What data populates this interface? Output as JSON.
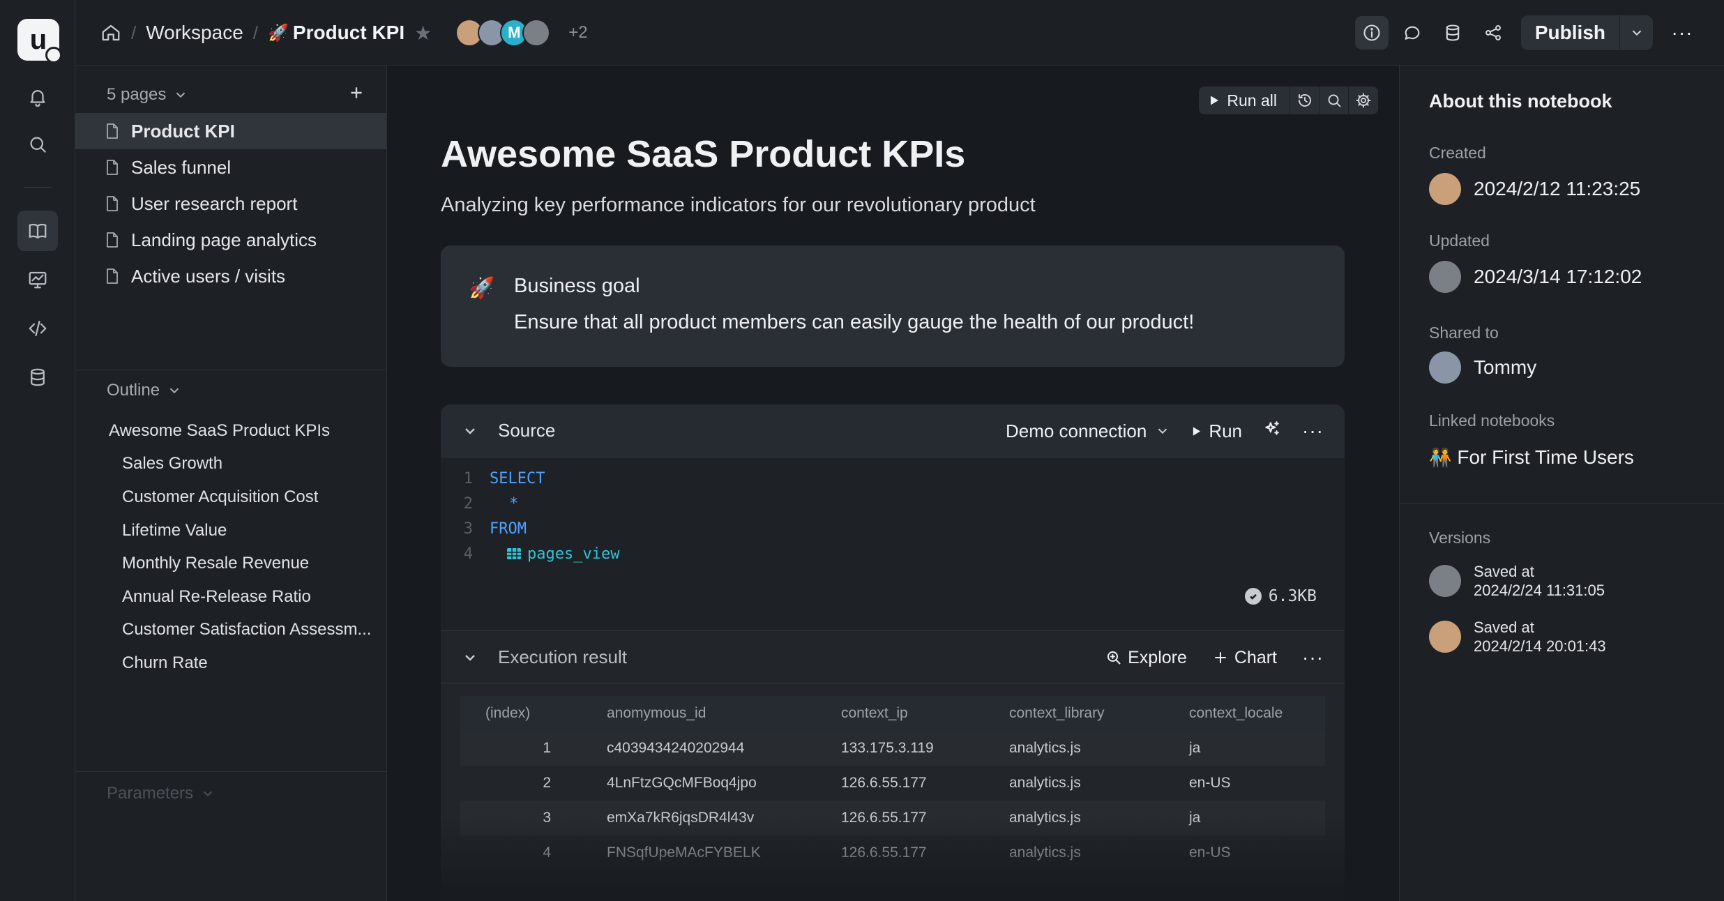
{
  "topbar": {
    "breadcrumb": {
      "workspace": "Workspace",
      "page_emoji": "🚀",
      "page": "Product KPI"
    },
    "collaborators": [
      {
        "initial": "",
        "color": "#c9a07a"
      },
      {
        "initial": "",
        "color": "#8a96a8"
      },
      {
        "initial": "M",
        "color": "#2bb0c9"
      },
      {
        "initial": "",
        "color": "#7b7f86"
      }
    ],
    "more_collaborators": "+2",
    "publish_label": "Publish"
  },
  "sidebar": {
    "pages_header": "5 pages",
    "pages": [
      {
        "label": "Product KPI",
        "active": true
      },
      {
        "label": "Sales funnel"
      },
      {
        "label": "User research report"
      },
      {
        "label": "Landing page analytics"
      },
      {
        "label": "Active users / visits"
      }
    ],
    "outline_header": "Outline",
    "outline": [
      {
        "label": "Awesome SaaS Product KPIs",
        "level": 1
      },
      {
        "label": "Sales Growth",
        "level": 2
      },
      {
        "label": "Customer Acquisition Cost",
        "level": 2
      },
      {
        "label": "Lifetime Value",
        "level": 2
      },
      {
        "label": "Monthly Resale Revenue",
        "level": 2
      },
      {
        "label": "Annual Re-Release Ratio",
        "level": 2
      },
      {
        "label": "Customer Satisfaction Assessm...",
        "level": 2
      },
      {
        "label": "Churn Rate",
        "level": 2
      }
    ],
    "parameters_header": "Parameters"
  },
  "main": {
    "run_all_label": "Run all",
    "title": "Awesome SaaS Product KPIs",
    "subtitle": "Analyzing key performance indicators for our revolutionary product",
    "callout": {
      "emoji": "🚀",
      "heading": "Business goal",
      "body": "Ensure that all product members can easily gauge the health of our product!"
    },
    "cell": {
      "name": "Source",
      "connection": "Demo connection",
      "run_label": "Run",
      "code": [
        {
          "ln": "1",
          "text": "SELECT",
          "kind": "kw"
        },
        {
          "ln": "2",
          "text": "*",
          "kind": "kw"
        },
        {
          "ln": "3",
          "text": "FROM",
          "kind": "kw"
        },
        {
          "ln": "4",
          "text": "pages_view",
          "kind": "table"
        }
      ],
      "size": "6.3KB",
      "result": {
        "name": "Execution result",
        "explore_label": "Explore",
        "chart_label": "Chart",
        "columns": [
          "(index)",
          "anomymous_id",
          "context_ip",
          "context_library",
          "context_locale"
        ],
        "rows": [
          [
            "1",
            "c4039434240202944",
            "133.175.3.119",
            "analytics.js",
            "ja"
          ],
          [
            "2",
            "4LnFtzGQcMFBoq4jpo",
            "126.6.55.177",
            "analytics.js",
            "en-US"
          ],
          [
            "3",
            "emXa7kR6jqsDR4l43v",
            "126.6.55.177",
            "analytics.js",
            "ja"
          ],
          [
            "4",
            "FNSqfUpeMAcFYBELK",
            "126.6.55.177",
            "analytics.js",
            "en-US"
          ]
        ]
      }
    }
  },
  "rpanel": {
    "title": "About this notebook",
    "created_label": "Created",
    "created": "2024/2/12 11:23:25",
    "updated_label": "Updated",
    "updated": "2024/3/14 17:12:02",
    "shared_label": "Shared to",
    "shared": "Tommy",
    "linked_label": "Linked notebooks",
    "linked_emoji": "🧑‍🤝‍🧑",
    "linked": "For First Time Users",
    "versions_label": "Versions",
    "versions": [
      {
        "label": "Saved at",
        "time": "2024/2/24 11:31:05"
      },
      {
        "label": "Saved at",
        "time": "2024/2/14 20:01:43"
      }
    ]
  }
}
